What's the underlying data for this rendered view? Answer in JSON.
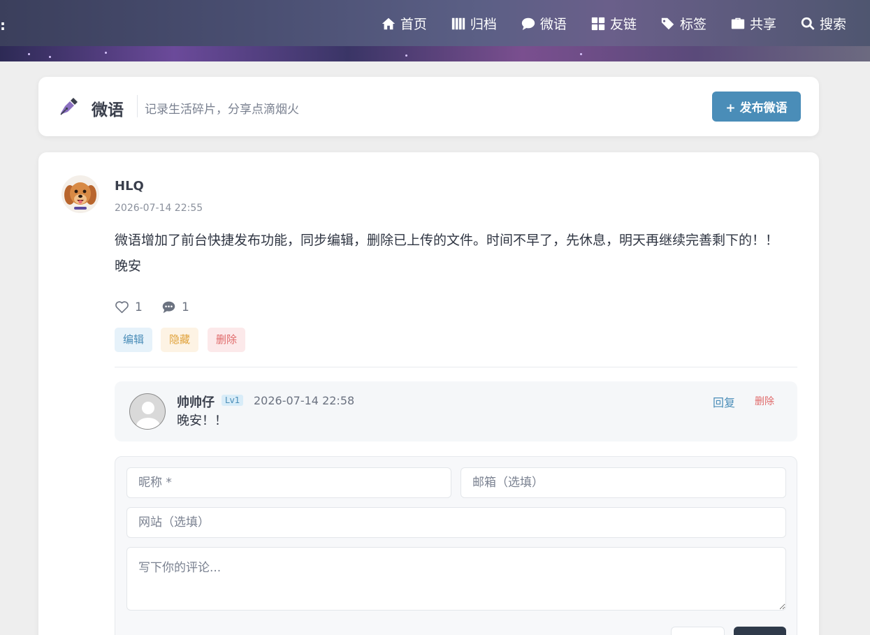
{
  "nav": {
    "items": [
      {
        "label": "首页",
        "icon": "home-icon"
      },
      {
        "label": "归档",
        "icon": "archive-icon"
      },
      {
        "label": "微语",
        "icon": "chat-bubble-icon"
      },
      {
        "label": "友链",
        "icon": "puzzle-icon"
      },
      {
        "label": "标签",
        "icon": "tags-icon"
      },
      {
        "label": "共享",
        "icon": "briefcase-icon"
      },
      {
        "label": "搜索",
        "icon": "search-icon"
      }
    ]
  },
  "page": {
    "title": "微语",
    "subtitle": "记录生活碎片，分享点滴烟火",
    "publish_label": "+ 发布微语"
  },
  "post": {
    "author": "HLQ",
    "time": "2026-07-14 22:55",
    "content": "微语增加了前台快捷发布功能，同步编辑，删除已上传的文件。时间不早了，先休息，明天再继续完善剩下的！！晚安",
    "likes": "1",
    "comments": "1",
    "actions": {
      "edit": "编辑",
      "hide": "隐藏",
      "delete": "删除"
    }
  },
  "comment": {
    "name": "帅帅仔",
    "level": "Lv1",
    "time": "2026-07-14 22:58",
    "text": "晚安！！",
    "reply_label": "回复",
    "delete_label": "删除"
  },
  "form": {
    "nickname_placeholder": "昵称 *",
    "email_placeholder": "邮箱（选填）",
    "website_placeholder": "网站（选填）",
    "comment_placeholder": "写下你的评论..."
  },
  "colors": {
    "accent": "#4a8db8",
    "danger": "#e06a6a",
    "warning": "#e0a23a"
  }
}
